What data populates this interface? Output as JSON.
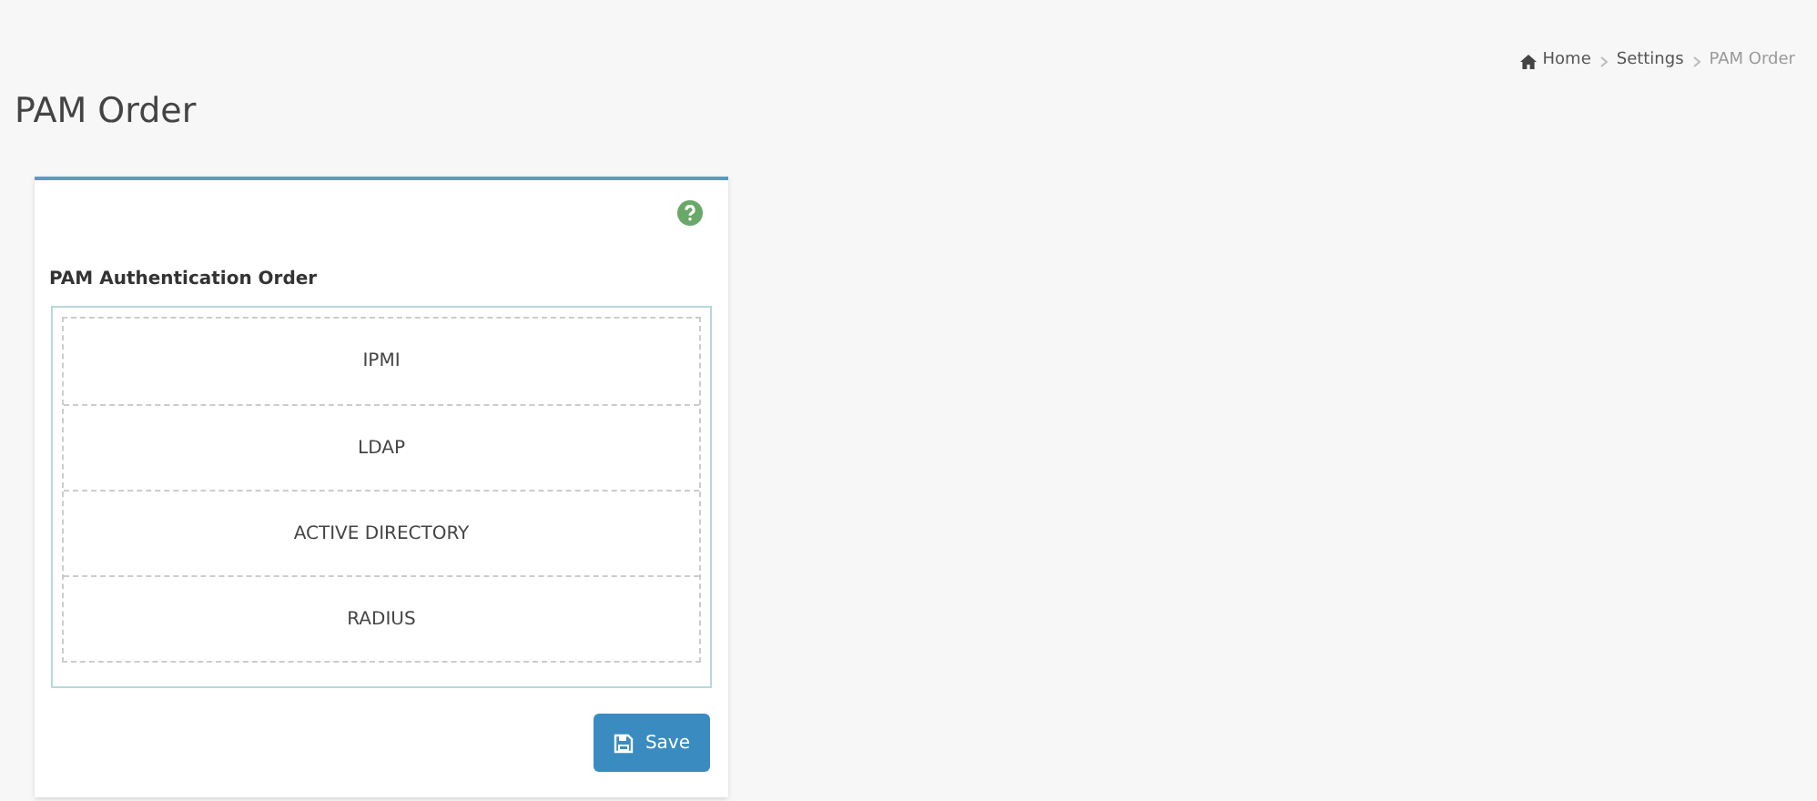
{
  "page_title": "PAM Order",
  "breadcrumb": [
    {
      "label": "Home",
      "kind": "home"
    },
    {
      "label": "Settings",
      "kind": "link"
    },
    {
      "label": "PAM Order",
      "kind": "current"
    }
  ],
  "card": {
    "section_label": "PAM Authentication Order",
    "items": [
      "IPMI",
      "LDAP",
      "ACTIVE DIRECTORY",
      "RADIUS"
    ],
    "save_button": "Save"
  }
}
